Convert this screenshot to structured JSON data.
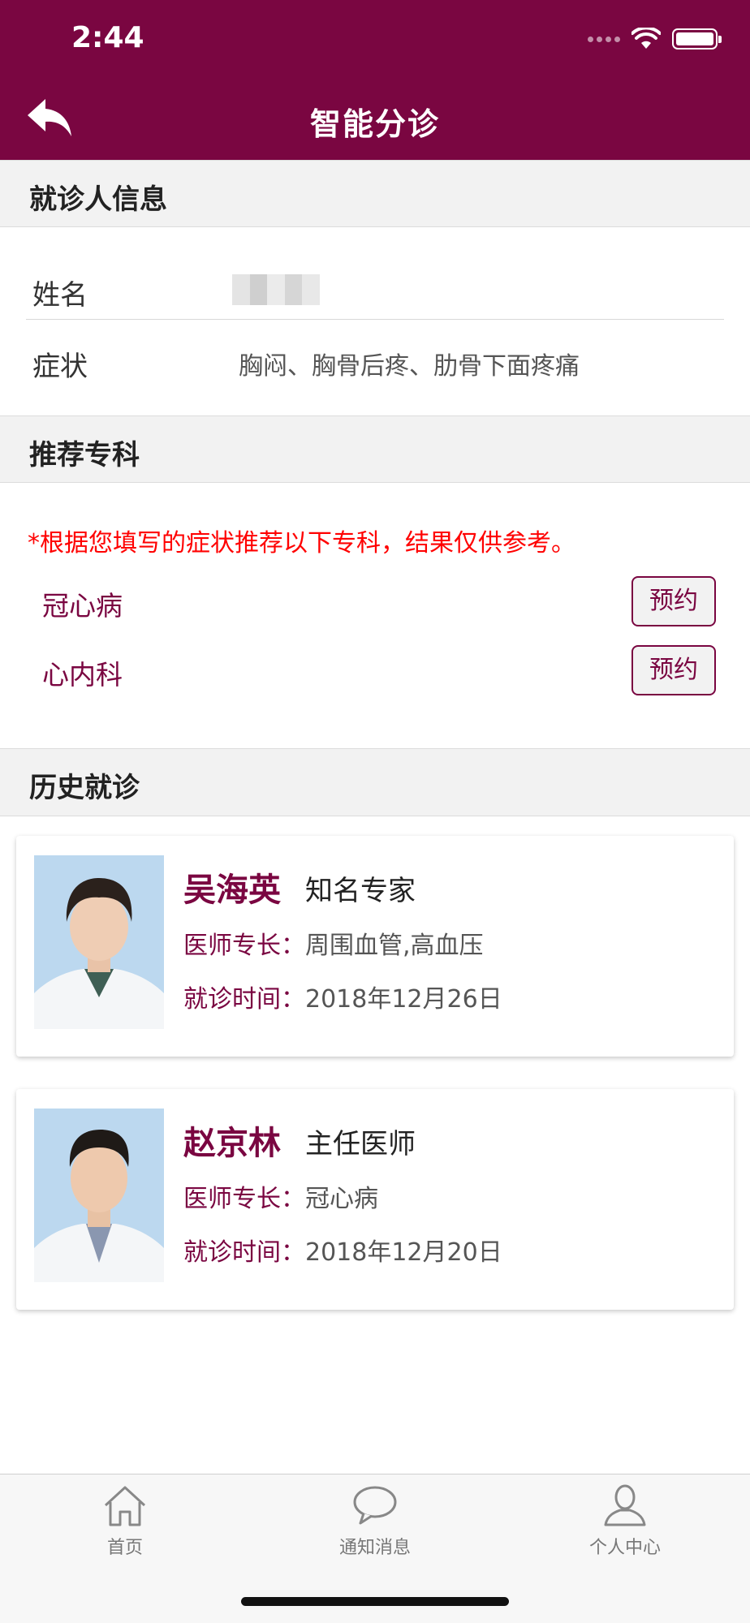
{
  "status_bar": {
    "time": "2:44"
  },
  "header": {
    "title": "智能分诊"
  },
  "patient_section": {
    "heading": "就诊人信息",
    "name_label": "姓名",
    "symptom_label": "症状",
    "symptom_value": "胸闷、胸骨后疼、肋骨下面疼痛"
  },
  "recommend_section": {
    "heading": "推荐专科",
    "notice": "*根据您填写的症状推荐以下专科，结果仅供参考。",
    "specialties": [
      {
        "name": "冠心病",
        "button": "预约"
      },
      {
        "name": "心内科",
        "button": "预约"
      }
    ]
  },
  "history_section": {
    "heading": "历史就诊",
    "expertise_label": "医师专长：",
    "visit_label": "就诊时间：",
    "doctors": [
      {
        "name": "吴海英",
        "title": "知名专家",
        "expertise": "周围血管,高血压",
        "visit_time": "2018年12月26日"
      },
      {
        "name": "赵京林",
        "title": "主任医师",
        "expertise": "冠心病",
        "visit_time": "2018年12月20日"
      }
    ]
  },
  "tabbar": {
    "tabs": [
      {
        "label": "首页",
        "icon": "home-icon"
      },
      {
        "label": "通知消息",
        "icon": "chat-bubble-icon"
      },
      {
        "label": "个人中心",
        "icon": "person-icon"
      }
    ]
  },
  "colors": {
    "brand": "#7a0641",
    "notice": "#ff0000",
    "section_bg": "#f2f2f2"
  }
}
